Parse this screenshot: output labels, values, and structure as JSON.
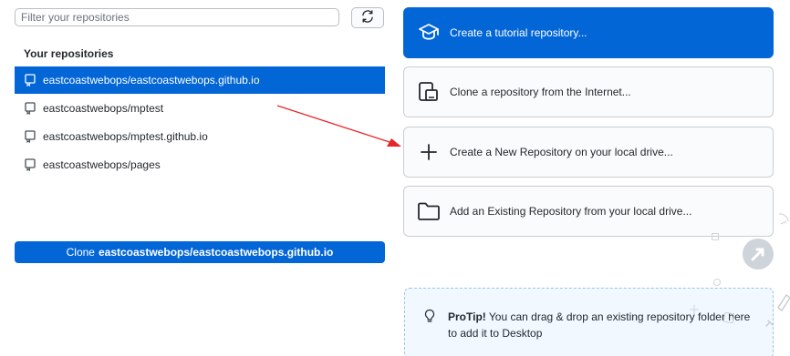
{
  "filter": {
    "placeholder": "Filter your repositories",
    "value": ""
  },
  "repositories": {
    "heading": "Your repositories",
    "items": [
      {
        "label": "eastcoastwebops/eastcoastwebops.github.io",
        "selected": true
      },
      {
        "label": "eastcoastwebops/mptest",
        "selected": false
      },
      {
        "label": "eastcoastwebops/mptest.github.io",
        "selected": false
      },
      {
        "label": "eastcoastwebops/pages",
        "selected": false
      }
    ]
  },
  "clone_button": {
    "prefix": "Clone",
    "repo": "eastcoastwebops/eastcoastwebops.github.io"
  },
  "actions": [
    {
      "label": "Create a tutorial repository...",
      "icon": "mortarboard-icon"
    },
    {
      "label": "Clone a repository from the Internet...",
      "icon": "device-clone-icon"
    },
    {
      "label": "Create a New Repository on your local drive...",
      "icon": "plus-icon"
    },
    {
      "label": "Add an Existing Repository from your local drive...",
      "icon": "folder-icon"
    }
  ],
  "protip": {
    "bold": "ProTip!",
    "text": "You can drag & drop an existing repository folder here to add it to Desktop"
  },
  "colors": {
    "accent": "#0366d6",
    "annotation_arrow": "#e8262a"
  }
}
